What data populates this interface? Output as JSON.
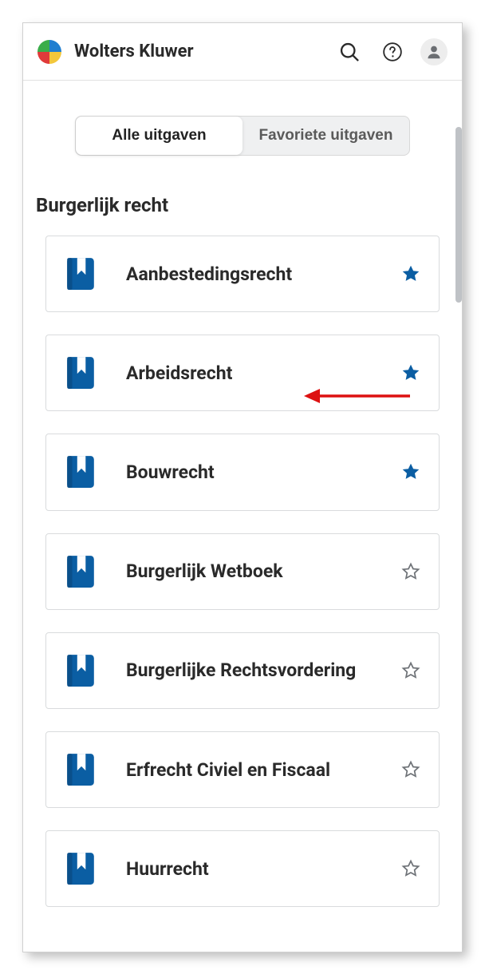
{
  "header": {
    "brand": "Wolters Kluwer"
  },
  "tabs": {
    "all": "Alle uitgaven",
    "fav": "Favoriete uitgaven"
  },
  "section": {
    "title": "Burgerlijk recht"
  },
  "items": [
    {
      "title": "Aanbestedingsrecht",
      "fav": true
    },
    {
      "title": "Arbeidsrecht",
      "fav": true
    },
    {
      "title": "Bouwrecht",
      "fav": true
    },
    {
      "title": "Burgerlijk Wetboek",
      "fav": false
    },
    {
      "title": "Burgerlijke Rechtsvordering",
      "fav": false
    },
    {
      "title": "Erfrecht Civiel en Fiscaal",
      "fav": false
    },
    {
      "title": "Huurrecht",
      "fav": false
    }
  ],
  "colors": {
    "accent": "#0b5ea3",
    "starOutline": "#6f7378"
  }
}
